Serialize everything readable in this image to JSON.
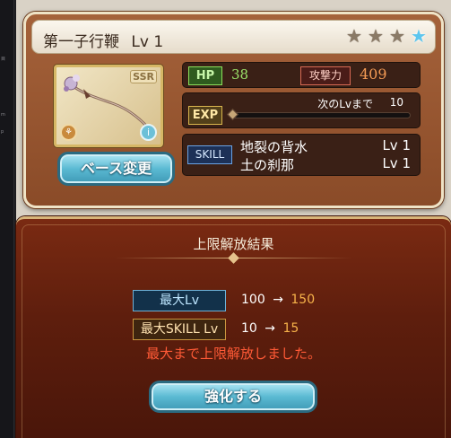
{
  "sidebar_strip": [
    "目",
    "m",
    "p"
  ],
  "item": {
    "name": "第一子行鞭",
    "level": "Lv 1",
    "rarity": "SSR",
    "stars": {
      "filled": 3,
      "total": 4,
      "icon": "star-icon"
    },
    "element_icon": "fire-element-icon",
    "info_icon": "info-icon"
  },
  "stats": {
    "hp_label": "HP",
    "hp": "38",
    "atk_label": "攻撃力",
    "atk": "409"
  },
  "exp": {
    "label": "EXP",
    "next_label": "次のLvまで",
    "next_value": "10",
    "progress": 0.0
  },
  "skill": {
    "label": "SKILL",
    "items": [
      {
        "name": "地裂の背水",
        "level": "Lv 1"
      },
      {
        "name": "土の刹那",
        "level": "Lv 1"
      }
    ]
  },
  "buttons": {
    "base_change": "ベース変更",
    "reinforce": "強化する"
  },
  "result": {
    "title": "上限解放結果",
    "max_lv_label": "最大Lv",
    "max_lv_old": "100",
    "max_lv_new": "150",
    "max_skill_label": "最大SKILL Lv",
    "max_skill_old": "10",
    "max_skill_new": "15",
    "arrow": "→",
    "message": "最大まで上限解放しました。"
  },
  "colors": {
    "card_frame": "#a5623a",
    "dialog_bg": "#5e1e0d",
    "accent_blue": "#5bbad3",
    "value_orange": "#f6b24a",
    "message_red": "#ff5a36"
  }
}
